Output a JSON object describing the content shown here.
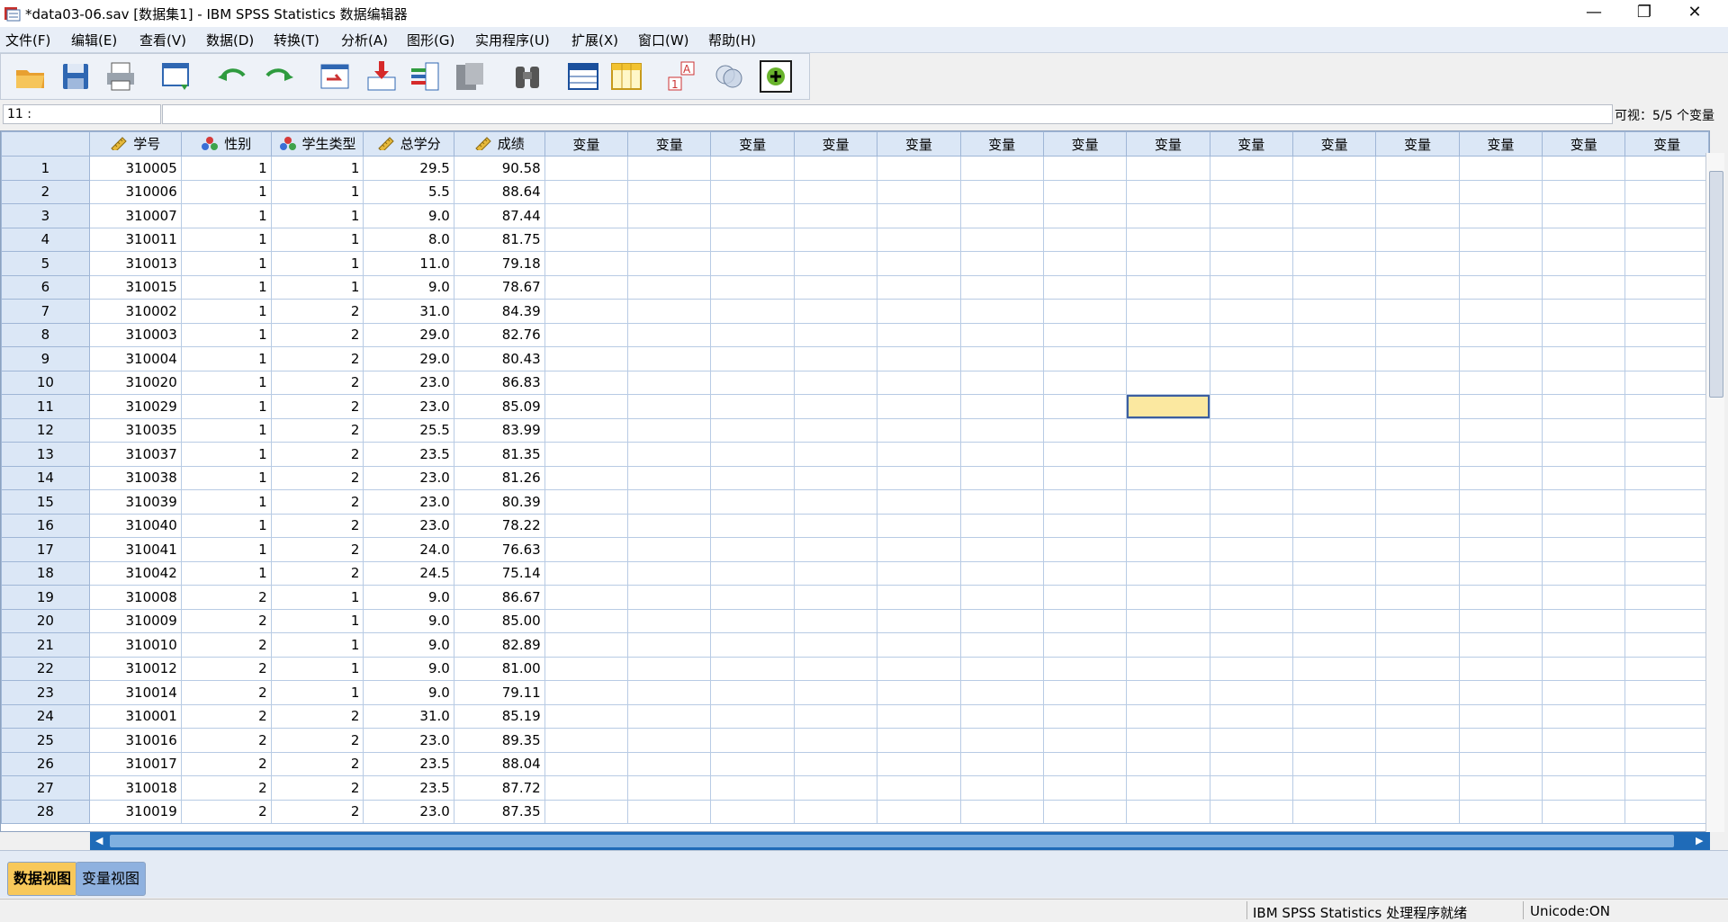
{
  "window": {
    "title": "*data03-06.sav [数据集1] - IBM SPSS Statistics 数据编辑器"
  },
  "menu": [
    "文件(F)",
    "编辑(E)",
    "查看(V)",
    "数据(D)",
    "转换(T)",
    "分析(A)",
    "图形(G)",
    "实用程序(U)",
    "扩展(X)",
    "窗口(W)",
    "帮助(H)"
  ],
  "toolbar": [
    "open-icon",
    "save-icon",
    "print-icon",
    "recall-dialog-icon",
    "undo-icon",
    "redo-icon",
    "goto-case-icon",
    "goto-variable-icon",
    "variables-icon",
    "run-descriptives-icon",
    "find-icon",
    "insert-cases-icon",
    "insert-variable-icon",
    "split-file-icon",
    "weight-cases-icon",
    "select-cases-icon",
    "value-labels-icon",
    "use-sets-icon",
    "spelling-icon"
  ],
  "cell_editor": {
    "ref": "11 :",
    "visible": "可视：5/5 个变量"
  },
  "grid": {
    "columns": [
      {
        "name": "学号",
        "type": "scale"
      },
      {
        "name": "性别",
        "type": "nominal"
      },
      {
        "name": "学生类型",
        "type": "nominal"
      },
      {
        "name": "总学分",
        "type": "scale"
      },
      {
        "name": "成绩",
        "type": "scale"
      }
    ],
    "empty_header": "变量",
    "rows": [
      [
        "310005",
        "1",
        "1",
        "29.5",
        "90.58"
      ],
      [
        "310006",
        "1",
        "1",
        "5.5",
        "88.64"
      ],
      [
        "310007",
        "1",
        "1",
        "9.0",
        "87.44"
      ],
      [
        "310011",
        "1",
        "1",
        "8.0",
        "81.75"
      ],
      [
        "310013",
        "1",
        "1",
        "11.0",
        "79.18"
      ],
      [
        "310015",
        "1",
        "1",
        "9.0",
        "78.67"
      ],
      [
        "310002",
        "1",
        "2",
        "31.0",
        "84.39"
      ],
      [
        "310003",
        "1",
        "2",
        "29.0",
        "82.76"
      ],
      [
        "310004",
        "1",
        "2",
        "29.0",
        "80.43"
      ],
      [
        "310020",
        "1",
        "2",
        "23.0",
        "86.83"
      ],
      [
        "310029",
        "1",
        "2",
        "23.0",
        "85.09"
      ],
      [
        "310035",
        "1",
        "2",
        "25.5",
        "83.99"
      ],
      [
        "310037",
        "1",
        "2",
        "23.5",
        "81.35"
      ],
      [
        "310038",
        "1",
        "2",
        "23.0",
        "81.26"
      ],
      [
        "310039",
        "1",
        "2",
        "23.0",
        "80.39"
      ],
      [
        "310040",
        "1",
        "2",
        "23.0",
        "78.22"
      ],
      [
        "310041",
        "1",
        "2",
        "24.0",
        "76.63"
      ],
      [
        "310042",
        "1",
        "2",
        "24.5",
        "75.14"
      ],
      [
        "310008",
        "2",
        "1",
        "9.0",
        "86.67"
      ],
      [
        "310009",
        "2",
        "1",
        "9.0",
        "85.00"
      ],
      [
        "310010",
        "2",
        "1",
        "9.0",
        "82.89"
      ],
      [
        "310012",
        "2",
        "1",
        "9.0",
        "81.00"
      ],
      [
        "310014",
        "2",
        "1",
        "9.0",
        "79.11"
      ],
      [
        "310001",
        "2",
        "2",
        "31.0",
        "85.19"
      ],
      [
        "310016",
        "2",
        "2",
        "23.0",
        "89.35"
      ],
      [
        "310017",
        "2",
        "2",
        "23.5",
        "88.04"
      ],
      [
        "310018",
        "2",
        "2",
        "23.5",
        "87.72"
      ],
      [
        "310019",
        "2",
        "2",
        "23.0",
        "87.35"
      ]
    ],
    "selected_row": 11
  },
  "tabs": {
    "data_view": "数据视图",
    "variable_view": "变量视图"
  },
  "status": {
    "processor": "IBM SPSS Statistics 处理程序就绪",
    "unicode": "Unicode:ON"
  },
  "colors": {
    "header_bg": "#dbe7f6",
    "selected_cell": "#fbe8a0",
    "active_tab": "#f8c85a",
    "scroll_blue": "#1f6bb8"
  }
}
